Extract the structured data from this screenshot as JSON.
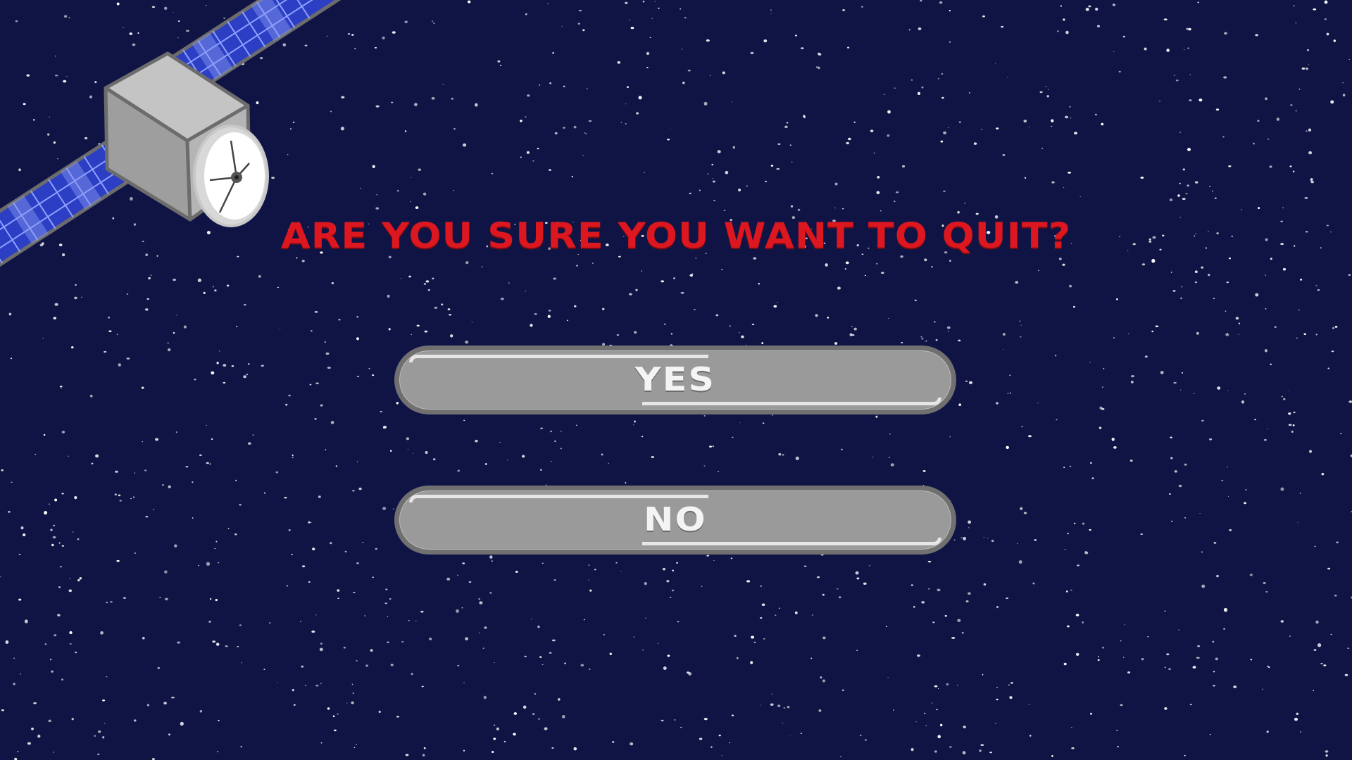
{
  "screen": {
    "background_color": "#101445",
    "star_color": "#ffffff"
  },
  "dialog": {
    "title": "ARE YOU SURE YOU WANT TO QUIT?",
    "title_color": "#dc1720"
  },
  "buttons": {
    "yes_label": "YES",
    "no_label": "NO",
    "fill_color": "#9a9a9a",
    "border_color": "#707070"
  },
  "decoration": {
    "icon": "satellite-icon",
    "panel_color": "#2b3ec4",
    "body_color": "#a8a8a8"
  }
}
